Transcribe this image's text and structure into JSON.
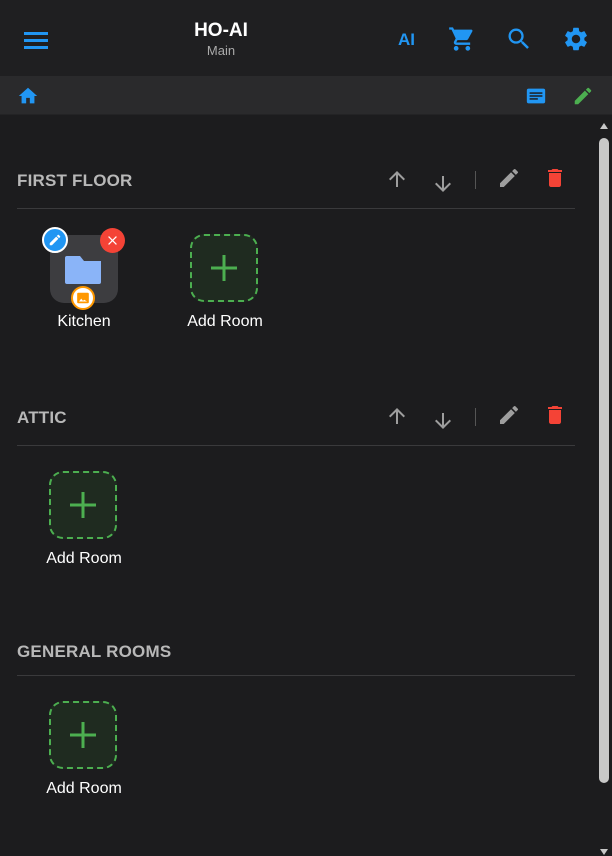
{
  "header": {
    "title": "HO-AI",
    "subtitle": "Main",
    "ai_label": "AI",
    "accent": "#2196f3"
  },
  "toolbar": {
    "icons": [
      "menu-icon",
      "cart-icon",
      "search-icon",
      "settings-icon",
      "home-icon",
      "list-view-icon",
      "edit-icon"
    ]
  },
  "sections": [
    {
      "title": "FIRST FLOOR",
      "rooms": [
        {
          "label": "Kitchen",
          "icon": "folder-icon"
        }
      ],
      "add_label": "Add Room",
      "editable": true
    },
    {
      "title": "ATTIC",
      "rooms": [],
      "add_label": "Add Room",
      "editable": true
    },
    {
      "title": "GENERAL ROOMS",
      "rooms": [],
      "add_label": "Add Room",
      "editable": false
    }
  ],
  "colors": {
    "add_green": "#4caf50",
    "delete_red": "#f44336",
    "edit_blue": "#2196f3",
    "image_badge": "#ff9800"
  }
}
